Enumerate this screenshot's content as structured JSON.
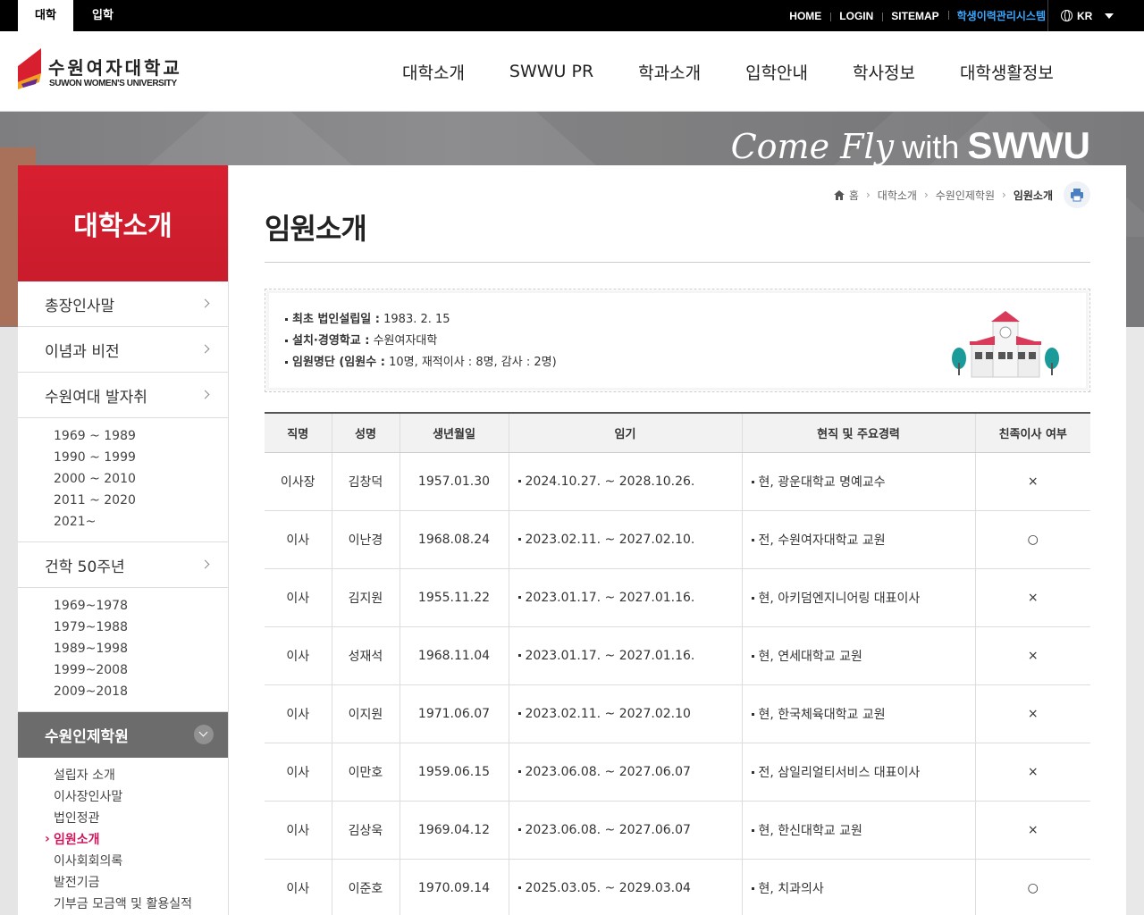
{
  "topbar": {
    "tabs": [
      "대학",
      "입학"
    ],
    "links": [
      "HOME",
      "LOGIN",
      "SITEMAP",
      "학생이력관리시스템"
    ],
    "language": "KR"
  },
  "header": {
    "logo_ko": "수원여자대학교",
    "logo_en": "SUWON WOMEN'S UNIVERSITY",
    "menu": [
      "대학소개",
      "SWWU PR",
      "학과소개",
      "입학안내",
      "학사정보",
      "대학생활정보"
    ]
  },
  "visual": {
    "slogan_script": "Come Fly",
    "slogan_with": "with",
    "slogan_brand": "SWWU"
  },
  "sidebar": {
    "title": "대학소개",
    "items": [
      {
        "label": "총장인사말"
      },
      {
        "label": "이념과 비전"
      },
      {
        "label": "수원여대 발자취"
      },
      {
        "label": "건학 50주년"
      },
      {
        "label": "수원인제학원"
      }
    ],
    "history_sub": [
      "1969 ~ 1989",
      "1990 ~ 1999",
      "2000 ~ 2010",
      "2011 ~ 2020",
      "2021~"
    ],
    "anniv_sub": [
      "1969~1978",
      "1979~1988",
      "1989~1998",
      "1999~2008",
      "2009~2018"
    ],
    "foundation_sub": [
      "설립자 소개",
      "이사장인사말",
      "법인정관",
      "임원소개",
      "이사회회의록",
      "발전기금",
      "기부금 모금액 및 활용실적"
    ]
  },
  "breadcrumb": [
    "홈",
    "대학소개",
    "수원인제학원",
    "임원소개"
  ],
  "page_title": "임원소개",
  "info": {
    "line1_label": "최초 법인설립일 :",
    "line1_value": "1983. 2. 15",
    "line2_label": "설치·경영학교 :",
    "line2_value": "수원여자대학",
    "line3_label": "임원명단 (임원수 :",
    "line3_value": "10명, 재적이사 : 8명, 감사 : 2명)"
  },
  "table": {
    "headers": [
      "직명",
      "성명",
      "생년월일",
      "임기",
      "현직 및 주요경력",
      "친족이사 여부"
    ],
    "rows": [
      [
        "이사장",
        "김창덕",
        "1957.01.30",
        "2024.10.27. ~ 2028.10.26.",
        "현, 광운대학교 명예교수",
        "×"
      ],
      [
        "이사",
        "이난경",
        "1968.08.24",
        "2023.02.11. ~ 2027.02.10.",
        "전, 수원여자대학교 교원",
        "○"
      ],
      [
        "이사",
        "김지원",
        "1955.11.22",
        "2023.01.17. ~ 2027.01.16.",
        "현, 아키덤엔지니어링 대표이사",
        "×"
      ],
      [
        "이사",
        "성재석",
        "1968.11.04",
        "2023.01.17. ~ 2027.01.16.",
        "현, 연세대학교 교원",
        "×"
      ],
      [
        "이사",
        "이지원",
        "1971.06.07",
        "2023.02.11. ~ 2027.02.10",
        "현, 한국체육대학교 교원",
        "×"
      ],
      [
        "이사",
        "이만호",
        "1959.06.15",
        "2023.06.08. ~ 2027.06.07",
        "전, 삼일리얼티서비스 대표이사",
        "×"
      ],
      [
        "이사",
        "김상욱",
        "1969.04.12",
        "2023.06.08. ~ 2027.06.07",
        "현, 한신대학교 교원",
        "×"
      ],
      [
        "이사",
        "이준호",
        "1970.09.14",
        "2025.03.05. ~ 2029.03.04",
        "현, 치과의사",
        "○"
      ]
    ]
  },
  "colors": {
    "accent_red": "#d81f30",
    "active_menu": "#d0165d",
    "topbar_link_highlight": "#3aa7ff"
  }
}
